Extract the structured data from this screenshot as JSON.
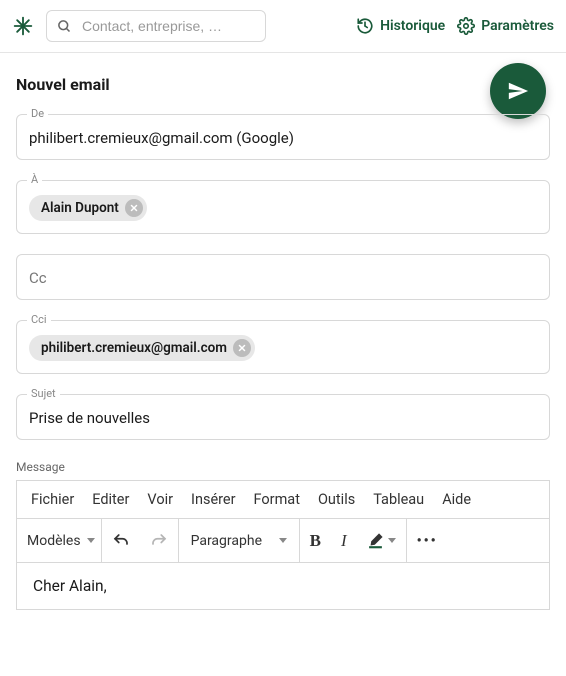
{
  "topbar": {
    "search_placeholder": "Contact, entreprise, …",
    "history_label": "Historique",
    "settings_label": "Paramètres"
  },
  "page": {
    "title": "Nouvel email"
  },
  "fields": {
    "from": {
      "label": "De",
      "value": "philibert.cremieux@gmail.com (Google)"
    },
    "to": {
      "label": "À",
      "chips": [
        "Alain Dupont"
      ]
    },
    "cc": {
      "label": "Cc"
    },
    "bcc": {
      "label": "Cci",
      "chips": [
        "philibert.cremieux@gmail.com"
      ]
    },
    "subject": {
      "label": "Sujet",
      "value": "Prise de nouvelles"
    },
    "message": {
      "label": "Message",
      "body": "Cher Alain,"
    }
  },
  "editor": {
    "menubar": {
      "file": "Fichier",
      "edit": "Editer",
      "view": "Voir",
      "insert": "Insérer",
      "format": "Format",
      "tools": "Outils",
      "table": "Tableau",
      "help": "Aide"
    },
    "toolbar": {
      "templates": "Modèles",
      "block_format": "Paragraphe"
    }
  },
  "colors": {
    "brand": "#1a5a3a"
  }
}
